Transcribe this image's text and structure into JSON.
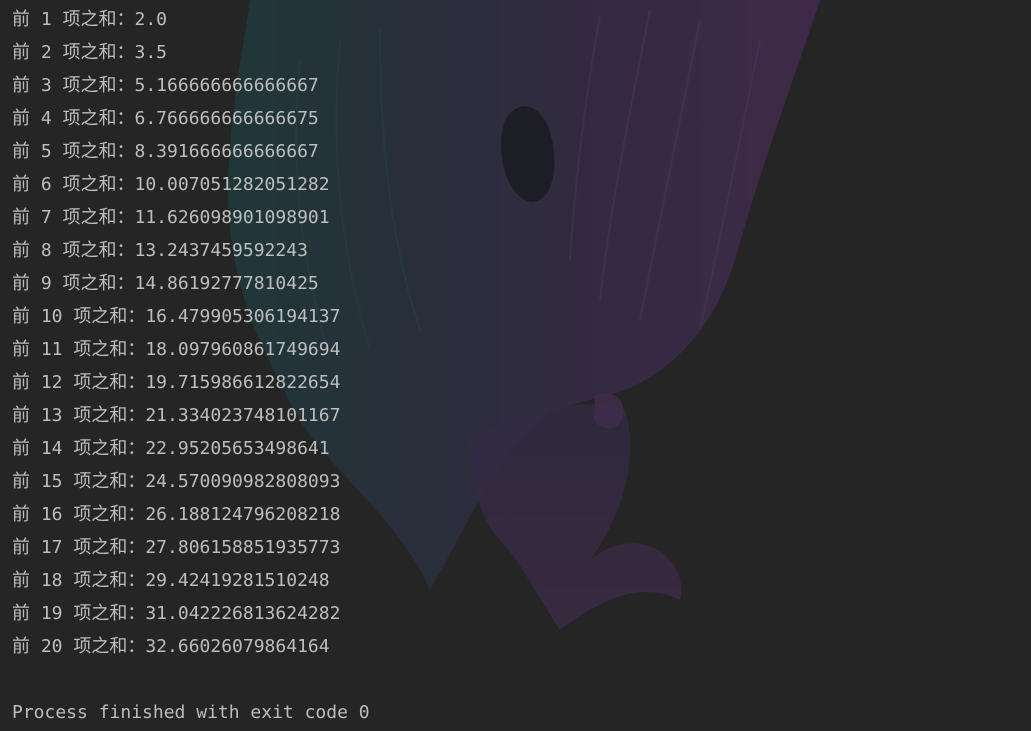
{
  "console": {
    "lines": [
      "前 1 项之和：2.0",
      "前 2 项之和：3.5",
      "前 3 项之和：5.166666666666667",
      "前 4 项之和：6.766666666666675",
      "前 5 项之和：8.391666666666667",
      "前 6 项之和：10.007051282051282",
      "前 7 项之和：11.626098901098901",
      "前 8 项之和：13.2437459592243",
      "前 9 项之和：14.86192777810425",
      "前 10 项之和：16.479905306194137",
      "前 11 项之和：18.097960861749694",
      "前 12 项之和：19.715986612822654",
      "前 13 项之和：21.334023748101167",
      "前 14 项之和：22.95205653498641",
      "前 15 项之和：24.570090982808093",
      "前 16 项之和：26.188124796208218",
      "前 17 项之和：27.806158851935773",
      "前 18 项之和：29.42419281510248",
      "前 19 项之和：31.042226813624282",
      "前 20 项之和：32.66026079864164"
    ],
    "exit_message": "Process finished with exit code 0"
  },
  "colors": {
    "background": "#252526",
    "text": "#bdbdbd"
  }
}
